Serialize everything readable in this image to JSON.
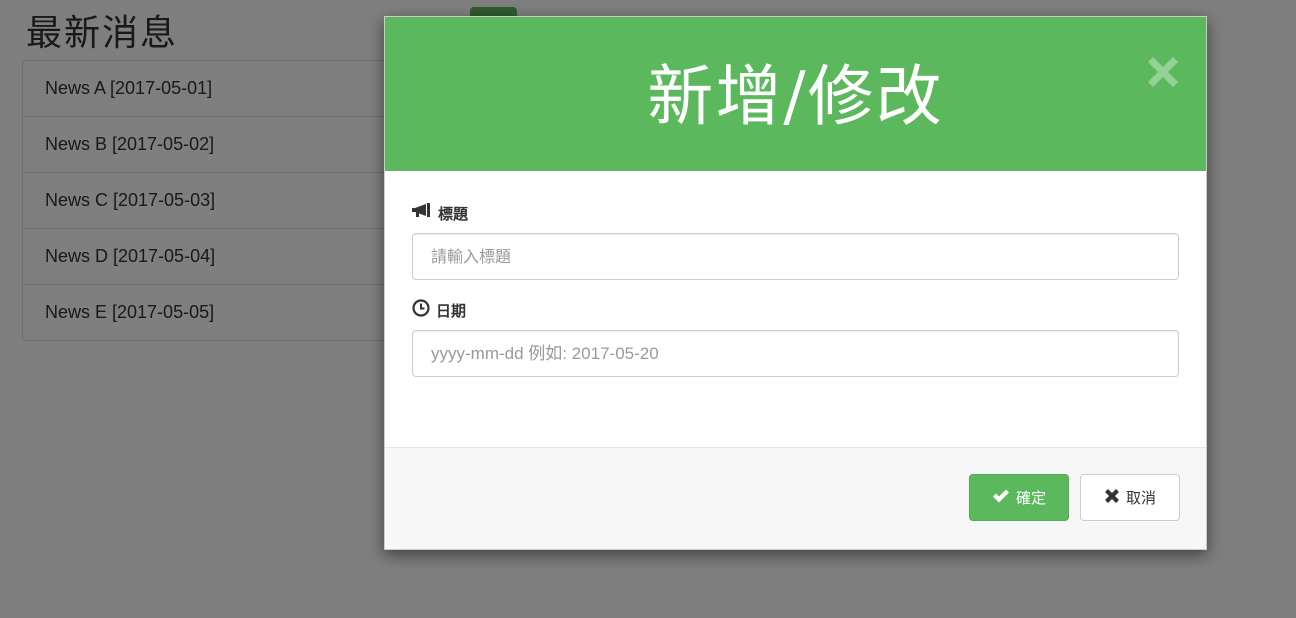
{
  "page": {
    "title": "最新消息"
  },
  "news": [
    {
      "label": "News A [2017-05-01]"
    },
    {
      "label": "News B [2017-05-02]"
    },
    {
      "label": "News C [2017-05-03]"
    },
    {
      "label": "News D [2017-05-04]"
    },
    {
      "label": "News E [2017-05-05]"
    }
  ],
  "modal": {
    "title": "新增/修改",
    "close_icon": "close-icon",
    "title_field": {
      "label": "標題",
      "icon": "bullhorn-icon",
      "placeholder": "請輸入標題",
      "value": ""
    },
    "date_field": {
      "label": "日期",
      "icon": "clock-icon",
      "placeholder": "yyyy-mm-dd 例如: 2017-05-20",
      "value": ""
    },
    "confirm_label": "確定",
    "cancel_label": "取消"
  },
  "colors": {
    "accent": "#5cb85c",
    "backdrop": "rgba(0,0,0,0.5)"
  }
}
